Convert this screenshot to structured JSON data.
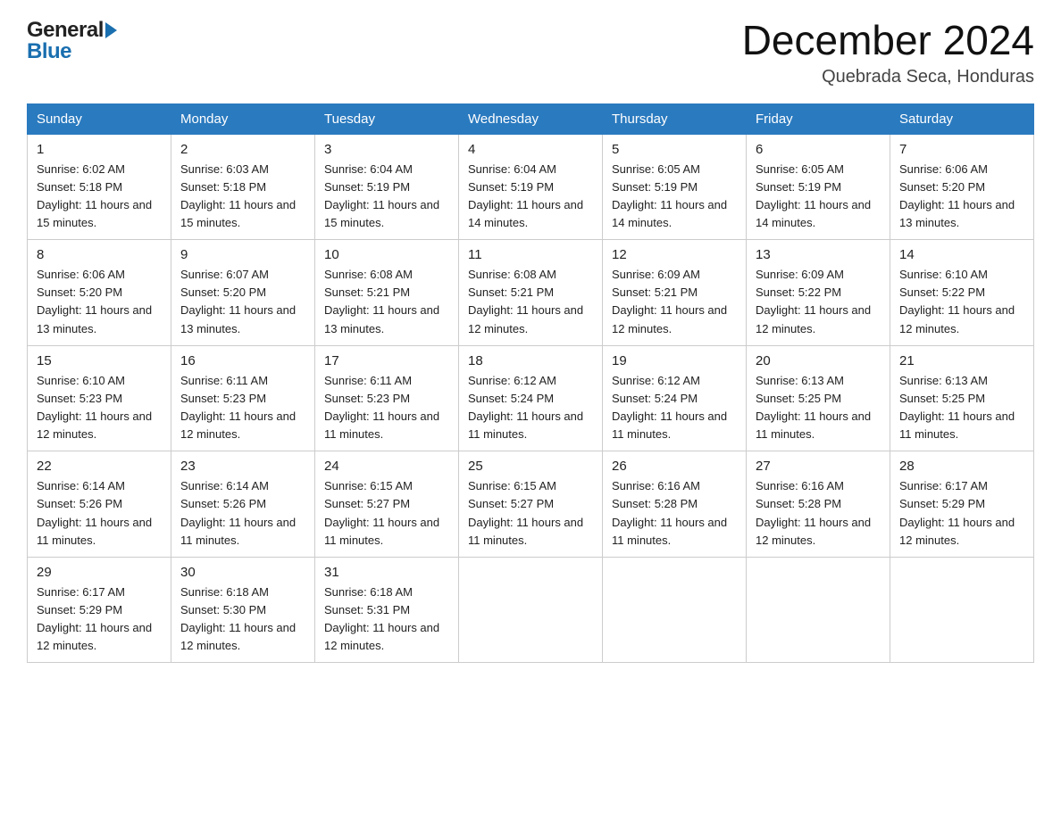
{
  "header": {
    "month_title": "December 2024",
    "location": "Quebrada Seca, Honduras",
    "logo_general": "General",
    "logo_blue": "Blue"
  },
  "days_of_week": [
    "Sunday",
    "Monday",
    "Tuesday",
    "Wednesday",
    "Thursday",
    "Friday",
    "Saturday"
  ],
  "weeks": [
    [
      {
        "day": "1",
        "sunrise": "6:02 AM",
        "sunset": "5:18 PM",
        "daylight": "11 hours and 15 minutes."
      },
      {
        "day": "2",
        "sunrise": "6:03 AM",
        "sunset": "5:18 PM",
        "daylight": "11 hours and 15 minutes."
      },
      {
        "day": "3",
        "sunrise": "6:04 AM",
        "sunset": "5:19 PM",
        "daylight": "11 hours and 15 minutes."
      },
      {
        "day": "4",
        "sunrise": "6:04 AM",
        "sunset": "5:19 PM",
        "daylight": "11 hours and 14 minutes."
      },
      {
        "day": "5",
        "sunrise": "6:05 AM",
        "sunset": "5:19 PM",
        "daylight": "11 hours and 14 minutes."
      },
      {
        "day": "6",
        "sunrise": "6:05 AM",
        "sunset": "5:19 PM",
        "daylight": "11 hours and 14 minutes."
      },
      {
        "day": "7",
        "sunrise": "6:06 AM",
        "sunset": "5:20 PM",
        "daylight": "11 hours and 13 minutes."
      }
    ],
    [
      {
        "day": "8",
        "sunrise": "6:06 AM",
        "sunset": "5:20 PM",
        "daylight": "11 hours and 13 minutes."
      },
      {
        "day": "9",
        "sunrise": "6:07 AM",
        "sunset": "5:20 PM",
        "daylight": "11 hours and 13 minutes."
      },
      {
        "day": "10",
        "sunrise": "6:08 AM",
        "sunset": "5:21 PM",
        "daylight": "11 hours and 13 minutes."
      },
      {
        "day": "11",
        "sunrise": "6:08 AM",
        "sunset": "5:21 PM",
        "daylight": "11 hours and 12 minutes."
      },
      {
        "day": "12",
        "sunrise": "6:09 AM",
        "sunset": "5:21 PM",
        "daylight": "11 hours and 12 minutes."
      },
      {
        "day": "13",
        "sunrise": "6:09 AM",
        "sunset": "5:22 PM",
        "daylight": "11 hours and 12 minutes."
      },
      {
        "day": "14",
        "sunrise": "6:10 AM",
        "sunset": "5:22 PM",
        "daylight": "11 hours and 12 minutes."
      }
    ],
    [
      {
        "day": "15",
        "sunrise": "6:10 AM",
        "sunset": "5:23 PM",
        "daylight": "11 hours and 12 minutes."
      },
      {
        "day": "16",
        "sunrise": "6:11 AM",
        "sunset": "5:23 PM",
        "daylight": "11 hours and 12 minutes."
      },
      {
        "day": "17",
        "sunrise": "6:11 AM",
        "sunset": "5:23 PM",
        "daylight": "11 hours and 11 minutes."
      },
      {
        "day": "18",
        "sunrise": "6:12 AM",
        "sunset": "5:24 PM",
        "daylight": "11 hours and 11 minutes."
      },
      {
        "day": "19",
        "sunrise": "6:12 AM",
        "sunset": "5:24 PM",
        "daylight": "11 hours and 11 minutes."
      },
      {
        "day": "20",
        "sunrise": "6:13 AM",
        "sunset": "5:25 PM",
        "daylight": "11 hours and 11 minutes."
      },
      {
        "day": "21",
        "sunrise": "6:13 AM",
        "sunset": "5:25 PM",
        "daylight": "11 hours and 11 minutes."
      }
    ],
    [
      {
        "day": "22",
        "sunrise": "6:14 AM",
        "sunset": "5:26 PM",
        "daylight": "11 hours and 11 minutes."
      },
      {
        "day": "23",
        "sunrise": "6:14 AM",
        "sunset": "5:26 PM",
        "daylight": "11 hours and 11 minutes."
      },
      {
        "day": "24",
        "sunrise": "6:15 AM",
        "sunset": "5:27 PM",
        "daylight": "11 hours and 11 minutes."
      },
      {
        "day": "25",
        "sunrise": "6:15 AM",
        "sunset": "5:27 PM",
        "daylight": "11 hours and 11 minutes."
      },
      {
        "day": "26",
        "sunrise": "6:16 AM",
        "sunset": "5:28 PM",
        "daylight": "11 hours and 11 minutes."
      },
      {
        "day": "27",
        "sunrise": "6:16 AM",
        "sunset": "5:28 PM",
        "daylight": "11 hours and 12 minutes."
      },
      {
        "day": "28",
        "sunrise": "6:17 AM",
        "sunset": "5:29 PM",
        "daylight": "11 hours and 12 minutes."
      }
    ],
    [
      {
        "day": "29",
        "sunrise": "6:17 AM",
        "sunset": "5:29 PM",
        "daylight": "11 hours and 12 minutes."
      },
      {
        "day": "30",
        "sunrise": "6:18 AM",
        "sunset": "5:30 PM",
        "daylight": "11 hours and 12 minutes."
      },
      {
        "day": "31",
        "sunrise": "6:18 AM",
        "sunset": "5:31 PM",
        "daylight": "11 hours and 12 minutes."
      },
      null,
      null,
      null,
      null
    ]
  ],
  "labels": {
    "sunrise_prefix": "Sunrise: ",
    "sunset_prefix": "Sunset: ",
    "daylight_prefix": "Daylight: "
  }
}
